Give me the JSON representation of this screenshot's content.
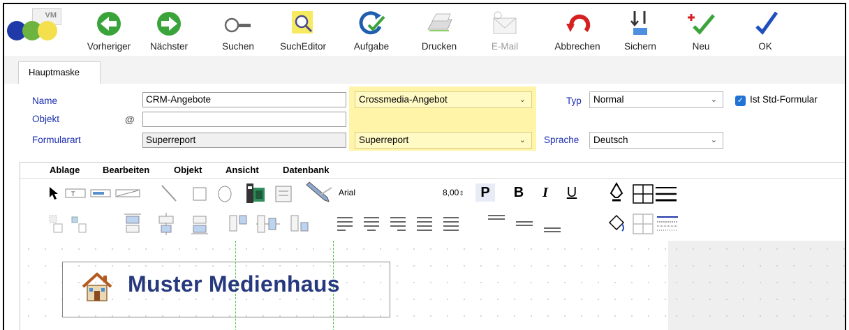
{
  "toolbar": {
    "logo_text": "VM",
    "logo_colors": [
      "#1f3aa8",
      "#6db33f",
      "#f4e04d"
    ],
    "buttons": [
      {
        "label": "Vorheriger",
        "icon": "arrow-left-icon",
        "color": "#3aa33a"
      },
      {
        "label": "Nächster",
        "icon": "arrow-right-icon",
        "color": "#3aa33a"
      },
      {
        "label": "Suchen",
        "icon": "key-search-icon",
        "color": "#6a6a6a"
      },
      {
        "label": "SuchEditor",
        "icon": "magnifier-icon",
        "color": "#f0e050"
      },
      {
        "label": "Aufgabe",
        "icon": "refresh-check-icon",
        "color": "#1f5fb0"
      },
      {
        "label": "Drucken",
        "icon": "printer-icon",
        "color": "#9a9a9a"
      },
      {
        "label": "E-Mail",
        "icon": "email-icon",
        "color": "#c0c0c0"
      },
      {
        "label": "Abbrechen",
        "icon": "undo-icon",
        "color": "#d42020"
      },
      {
        "label": "Sichern",
        "icon": "save-icon",
        "color": "#444444"
      },
      {
        "label": "Neu",
        "icon": "new-check-icon",
        "color": "#3aa33a"
      },
      {
        "label": "OK",
        "icon": "check-icon",
        "color": "#1f4fc0"
      }
    ]
  },
  "tabs": [
    {
      "label": "Hauptmaske"
    }
  ],
  "form": {
    "name_label": "Name",
    "name_value": "CRM-Angebote",
    "name_combo": "Crossmedia-Angebot",
    "objekt_label": "Objekt",
    "objekt_value": "",
    "objekt_at": "@",
    "formularart_label": "Formularart",
    "formularart_value": "Superreport",
    "formularart_combo": "Superreport",
    "typ_label": "Typ",
    "typ_value": "Normal",
    "sprache_label": "Sprache",
    "sprache_value": "Deutsch",
    "std_label": "Ist Std-Formular",
    "std_checked": true
  },
  "designer": {
    "menu": [
      "Ablage",
      "Bearbeiten",
      "Objekt",
      "Ansicht",
      "Datenbank"
    ],
    "font_name": "Arial",
    "font_size": "8,00",
    "format_buttons": [
      "P",
      "B",
      "I",
      "U"
    ],
    "brand_text": "Muster Medienhaus"
  },
  "colors": {
    "label_blue": "#1a2db0",
    "highlight_yellow": "#fff4a8",
    "brand_navy": "#27397e",
    "guide_green": "#49c649"
  }
}
